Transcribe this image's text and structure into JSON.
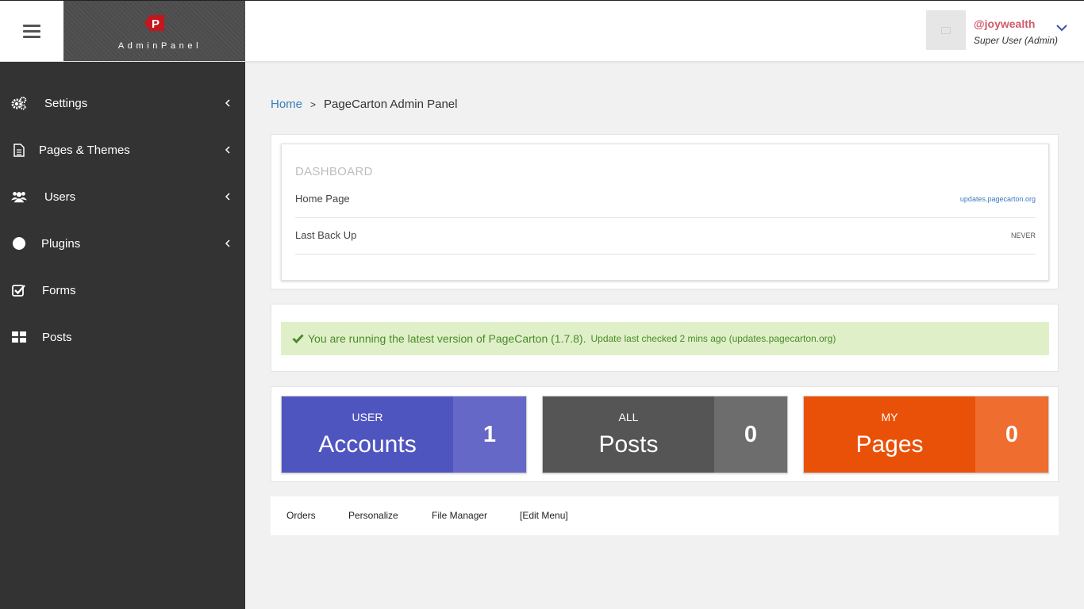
{
  "header": {
    "brand_text": "AdminPanel",
    "logo_letter": "P",
    "user": {
      "username": "@joywealth",
      "role": "Super User (Admin)"
    }
  },
  "sidebar": {
    "items": [
      {
        "label": "Settings",
        "icon": "gears-icon",
        "has_submenu": true
      },
      {
        "label": "Pages & Themes",
        "icon": "document-icon",
        "has_submenu": true
      },
      {
        "label": "Users",
        "icon": "users-icon",
        "has_submenu": true
      },
      {
        "label": "Plugins",
        "icon": "circle-icon",
        "has_submenu": true
      },
      {
        "label": "Forms",
        "icon": "checkbox-icon",
        "has_submenu": false
      },
      {
        "label": "Posts",
        "icon": "grid-icon",
        "has_submenu": false
      }
    ]
  },
  "breadcrumb": {
    "home": "Home",
    "separator": ">",
    "current": "PageCarton Admin Panel"
  },
  "dashboard": {
    "title": "DASHBOARD",
    "rows": [
      {
        "label": "Home Page",
        "value": "updates.pagecarton.org"
      },
      {
        "label": "Last Back Up",
        "value": "NEVER"
      }
    ]
  },
  "alert": {
    "message": "You are running the latest version of PageCarton (1.7.8).",
    "sub": "Update last checked 2 mins ago (updates.pagecarton.org)",
    "icon": "check-icon"
  },
  "stats": [
    {
      "top": "USER",
      "big": "Accounts",
      "count": "1",
      "main_color": "#4f55bf",
      "side_color": "#6568c6"
    },
    {
      "top": "ALL",
      "big": "Posts",
      "count": "0",
      "main_color": "#555555",
      "side_color": "#6d6d6d"
    },
    {
      "top": "MY",
      "big": "Pages",
      "count": "0",
      "main_color": "#ea5108",
      "side_color": "#ee6d2f"
    }
  ],
  "quick_links": [
    "Orders",
    "Personalize",
    "File Manager",
    "[Edit Menu]"
  ],
  "colors": {
    "sidebar_bg": "#333333",
    "link": "#3b7bbf",
    "username": "#d05a6a",
    "success_bg": "#dff0c8",
    "success_text": "#4a8a2a"
  }
}
